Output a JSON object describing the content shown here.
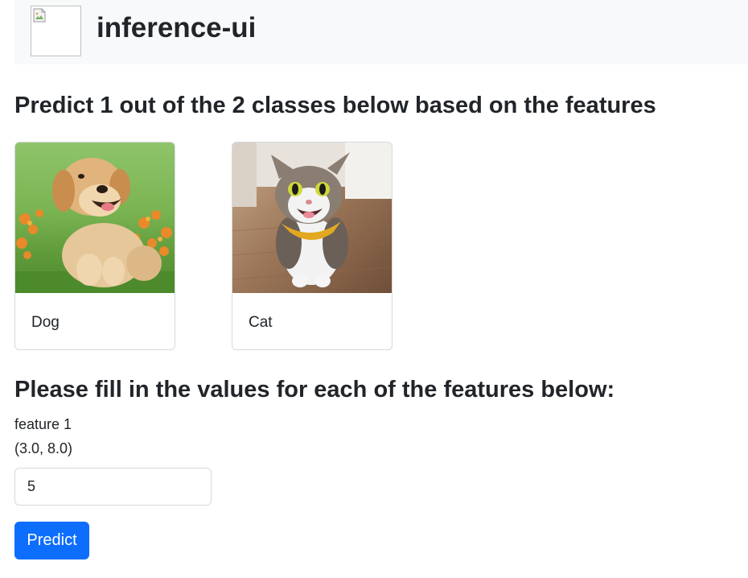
{
  "header": {
    "title": "inference-ui",
    "logo_icon": "broken-image-icon"
  },
  "main": {
    "heading": "Predict 1 out of the 2 classes below based on the features",
    "classes": [
      {
        "label": "Dog",
        "image": "puppy-photo"
      },
      {
        "label": "Cat",
        "image": "cat-photo"
      }
    ],
    "features_heading": "Please fill in the values for each of the features below:",
    "features": [
      {
        "name": "feature 1",
        "range": "(3.0, 8.0)",
        "value": "5"
      }
    ],
    "predict_label": "Predict"
  },
  "colors": {
    "primary": "#0d6efd",
    "navbar_bg": "#f8f9fa",
    "text": "#212529"
  }
}
